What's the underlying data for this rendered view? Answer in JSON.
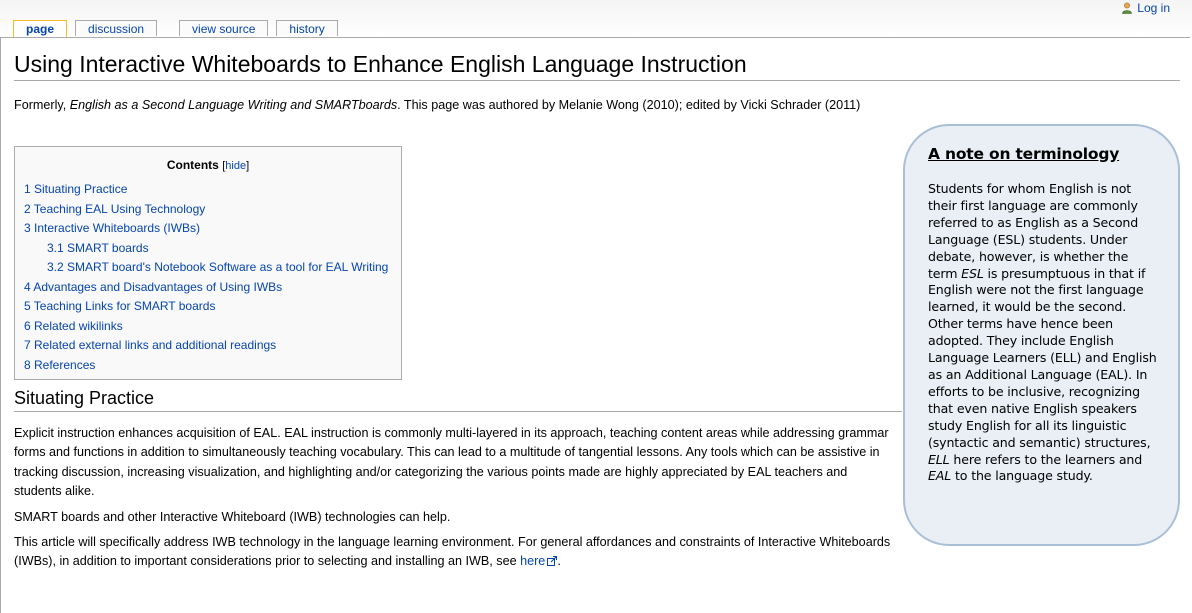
{
  "tabs": [
    {
      "label": "page",
      "selected": true
    },
    {
      "label": "discussion",
      "selected": false
    },
    {
      "label": "view source",
      "selected": false
    },
    {
      "label": "history",
      "selected": false
    }
  ],
  "login": {
    "label": "Log in",
    "icon": "user-icon"
  },
  "page_title": "Using Interactive Whiteboards to Enhance English Language Instruction",
  "formerly": {
    "prefix": "Formerly, ",
    "old_title": "English as a Second Language Writing and SMARTboards",
    "suffix": ". This page was authored by Melanie Wong (2010); edited by Vicki Schrader (2011)"
  },
  "toc": {
    "title": "Contents",
    "hide_label": "hide",
    "items": [
      {
        "label": "1 Situating Practice",
        "level": 1
      },
      {
        "label": "2 Teaching EAL Using Technology",
        "level": 1
      },
      {
        "label": "3 Interactive Whiteboards (IWBs)",
        "level": 1
      },
      {
        "label": "3.1 SMART boards",
        "level": 2
      },
      {
        "label": "3.2 SMART board's Notebook Software as a tool for EAL Writing",
        "level": 2
      },
      {
        "label": "4 Advantages and Disadvantages of Using IWBs",
        "level": 1
      },
      {
        "label": "5 Teaching Links for SMART boards",
        "level": 1
      },
      {
        "label": "6 Related wikilinks",
        "level": 1
      },
      {
        "label": "7 Related external links and additional readings",
        "level": 1
      },
      {
        "label": "8 References",
        "level": 1
      }
    ]
  },
  "note": {
    "title": "A note on terminology",
    "body_1": "Students for whom English is not their first language are commonly referred to as English as a Second Language (ESL) students.  Under debate, however, is whether the term ",
    "body_em_1": "ESL",
    "body_2": " is presumptuous in that if English were not the first language learned, it would be the second.  Other terms have hence been adopted.  They include English Language Learners (ELL) and English as an Additional Language (EAL).  In efforts to be inclusive, recognizing that even native English speakers study English for all its linguistic (syntactic and semantic) structures, ",
    "body_em_2": "ELL",
    "body_3": " here refers to the learners and ",
    "body_em_3": "EAL",
    "body_4": " to the language study."
  },
  "section": {
    "heading": "Situating Practice",
    "p1": "Explicit instruction enhances acquisition of EAL. EAL instruction is commonly multi-layered in its approach, teaching content areas while addressing grammar forms and functions in addition to simultaneously teaching vocabulary. This can lead to a multitude of tangential lessons. Any tools which can be assistive in tracking discussion, increasing visualization, and highlighting and/or categorizing the various points made are highly appreciated by EAL teachers and students alike.",
    "p2": "SMART boards and other Interactive Whiteboard (IWB) technologies can help.",
    "p3_text": "This article will specifically address IWB technology in the language learning environment. For general affordances and constraints of Interactive Whiteboards (IWBs), in addition to important considerations prior to selecting and installing an IWB, see ",
    "p3_link": "here",
    "p3_end": "."
  },
  "colors": {
    "link": "#0645ad",
    "note_bg": "#eaeff6",
    "note_border": "#a9bfd6",
    "selected_tab_border": "#fabd23"
  }
}
